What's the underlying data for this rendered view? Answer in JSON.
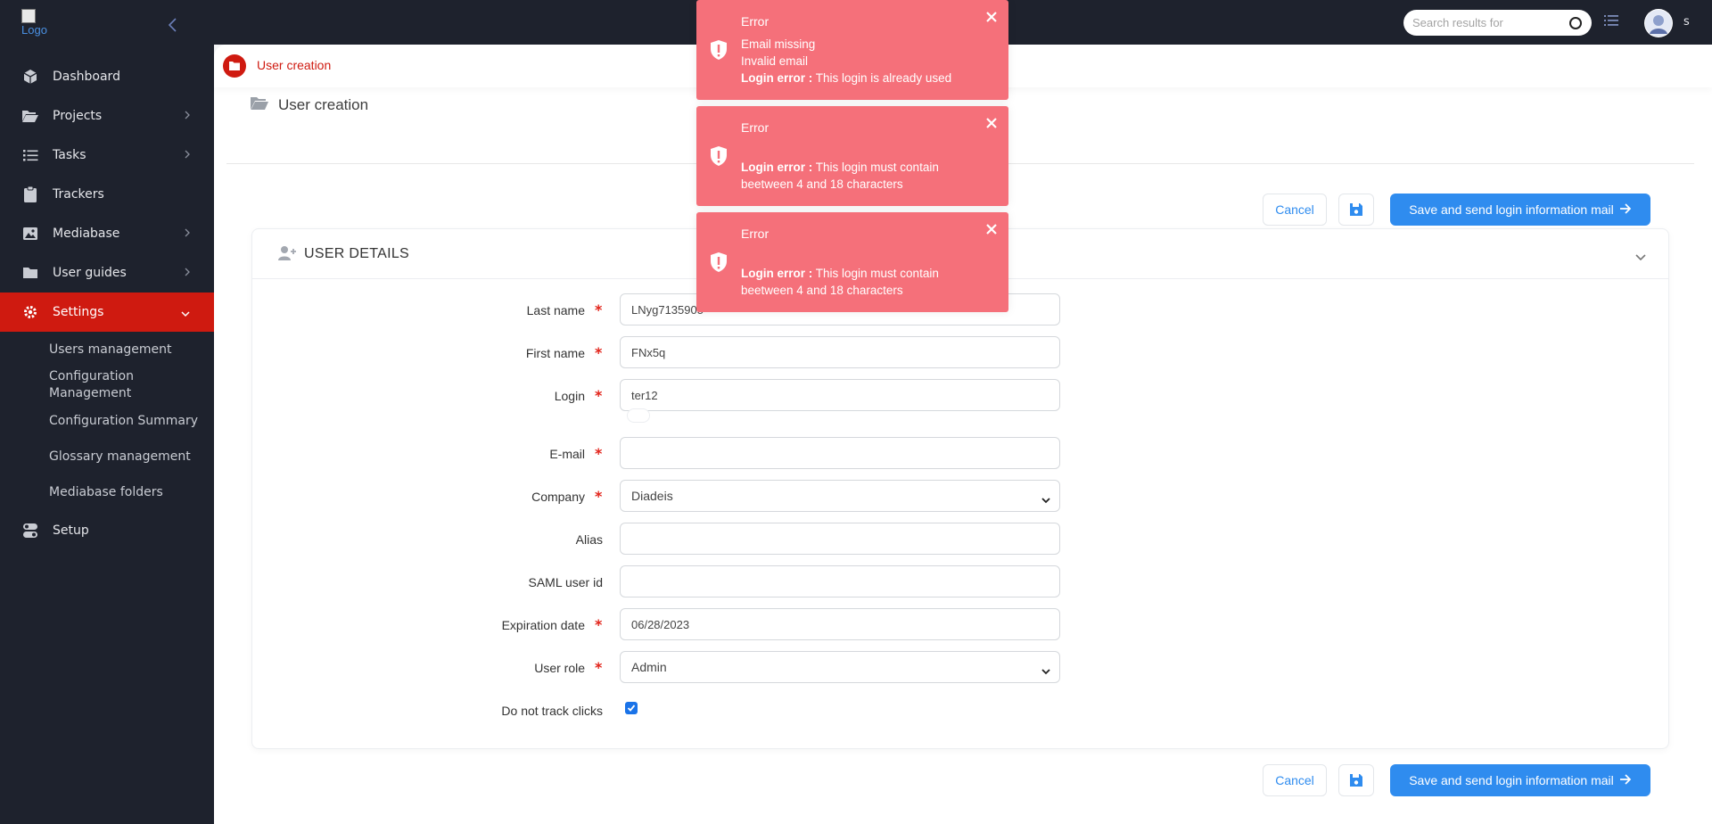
{
  "sidebar": {
    "logo_alt": "Logo",
    "items": [
      {
        "label": "Dashboard",
        "icon": "cube-icon"
      },
      {
        "label": "Projects",
        "icon": "folder-open-icon"
      },
      {
        "label": "Tasks",
        "icon": "list-icon"
      },
      {
        "label": "Trackers",
        "icon": "clipboard-icon"
      },
      {
        "label": "Mediabase",
        "icon": "image-icon"
      },
      {
        "label": "User guides",
        "icon": "folder-icon"
      },
      {
        "label": "Settings",
        "icon": "gear-icon"
      },
      {
        "label": "Setup",
        "icon": "toggle-icon"
      }
    ],
    "settings_sub": [
      "Users management",
      "Configuration Management",
      "Configuration Summary",
      "Glossary management",
      "Mediabase folders"
    ]
  },
  "topbar": {
    "search_placeholder": "Search results for",
    "user_initial": "s"
  },
  "breadcrumb": {
    "label": "User creation"
  },
  "page": {
    "title": "User creation"
  },
  "actions": {
    "cancel": "Cancel",
    "save_send": "Save and send login information mail"
  },
  "card": {
    "title": "USER DETAILS"
  },
  "form": {
    "last_name": {
      "label": "Last name",
      "value": "LNyg7135905",
      "required": true
    },
    "first_name": {
      "label": "First name",
      "value": "FNx5q",
      "required": true
    },
    "login": {
      "label": "Login",
      "value": "ter12",
      "required": true
    },
    "email": {
      "label": "E-mail",
      "value": "",
      "required": true
    },
    "company": {
      "label": "Company",
      "value": "Diadeis",
      "required": true
    },
    "alias": {
      "label": "Alias",
      "value": ""
    },
    "saml": {
      "label": "SAML user id",
      "value": ""
    },
    "expiration": {
      "label": "Expiration date",
      "value": "06/28/2023",
      "required": true
    },
    "role": {
      "label": "User role",
      "value": "Admin",
      "required": true
    },
    "track": {
      "label": "Do not track clicks",
      "checked": true
    }
  },
  "toasts": [
    {
      "title": "Error",
      "lines": [
        "Email missing",
        "Invalid email"
      ],
      "bold": "Login error :",
      "msg": "This login is already used"
    },
    {
      "title": "Error",
      "bold": "Login error :",
      "msg": "This login must contain",
      "msg2": "beetween 4 and 18 characters"
    },
    {
      "title": "Error",
      "bold": "Login error :",
      "msg": "This login must contain",
      "msg2": "beetween 4 and 18 characters"
    }
  ],
  "colors": {
    "sidebar": "#1e222d",
    "accent_red": "#cf1a10",
    "primary": "#2f8cef",
    "toast": "#f5707a"
  }
}
